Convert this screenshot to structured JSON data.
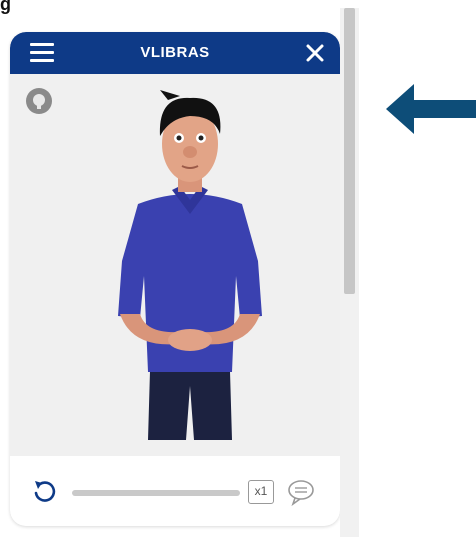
{
  "page": {
    "partial_heading": "g"
  },
  "widget": {
    "title": "VLIBRAS",
    "speed_label": "x1",
    "progress": 0,
    "icons": {
      "menu": "hamburger-menu-icon",
      "close": "close-icon",
      "hint": "dictionary-hint-icon",
      "replay": "replay-icon",
      "subtitles": "subtitles-icon"
    }
  },
  "colors": {
    "header": "#0e3a87",
    "arrow": "#0d4d78",
    "shirt": "#3a41b0"
  }
}
